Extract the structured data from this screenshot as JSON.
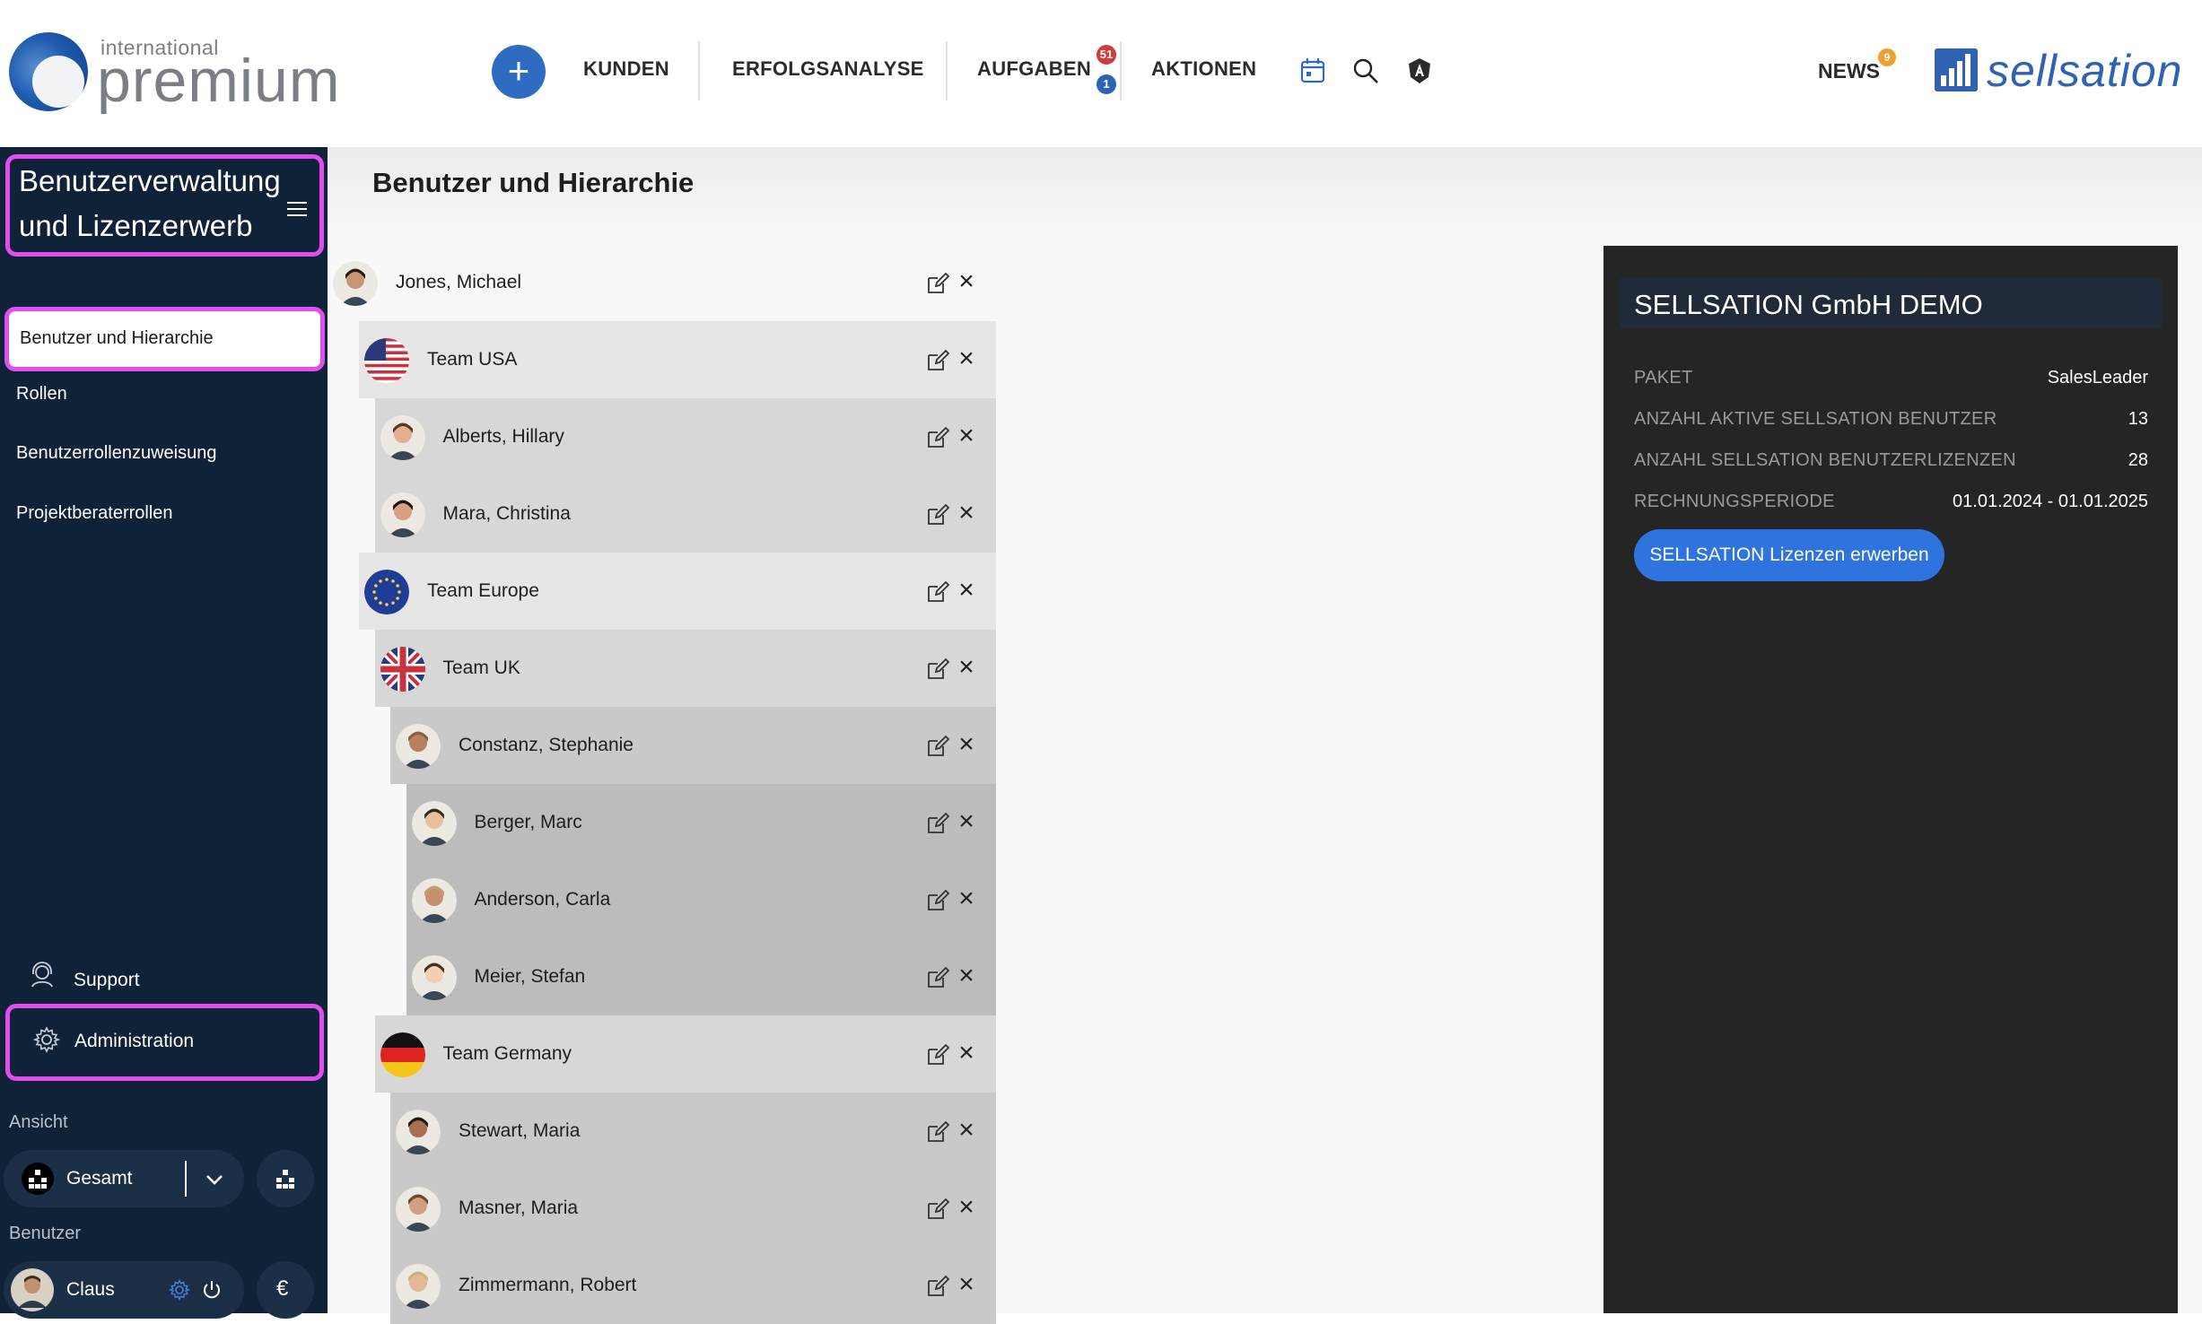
{
  "header": {
    "logo_small": "international",
    "logo_big": "premium",
    "nav": [
      "KUNDEN",
      "ERFOLGSANALYSE",
      "AUFGABEN",
      "AKTIONEN"
    ],
    "aufgaben_badge_red": "51",
    "aufgaben_badge_blue": "1",
    "news_label": "NEWS",
    "news_badge": "9",
    "brand": "sellsation",
    "accent_color": "#2e6cc2",
    "icons": [
      "plus-icon",
      "calendar-icon",
      "search-icon",
      "shield-icon"
    ]
  },
  "sidebar": {
    "title": "Benutzerverwaltung und Lizenzerwerb",
    "items": [
      "Benutzer und Hierarchie",
      "Rollen",
      "Benutzerrollenzuweisung",
      "Projektberaterrollen"
    ],
    "active_item": "Benutzer und Hierarchie",
    "support_label": "Support",
    "admin_label": "Administration",
    "view_caption": "Ansicht",
    "view_value": "Gesamt",
    "user_caption": "Benutzer",
    "user_name": "Claus",
    "currency_symbol": "€",
    "highlight_color": "#e14ef0"
  },
  "page": {
    "title": "Benutzer und Hierarchie"
  },
  "hierarchy": [
    {
      "name": "Jones, Michael",
      "level": 0,
      "type": "user"
    },
    {
      "name": "Team USA",
      "level": 1,
      "type": "team",
      "flag": "us"
    },
    {
      "name": "Alberts, Hillary",
      "level": 2,
      "type": "user"
    },
    {
      "name": "Mara, Christina",
      "level": 2,
      "type": "user"
    },
    {
      "name": "Team Europe",
      "level": 1,
      "type": "team",
      "flag": "eu"
    },
    {
      "name": "Team UK",
      "level": 2,
      "type": "team",
      "flag": "uk"
    },
    {
      "name": "Constanz, Stephanie",
      "level": 3,
      "type": "user"
    },
    {
      "name": "Berger, Marc",
      "level": 4,
      "type": "user"
    },
    {
      "name": "Anderson, Carla",
      "level": 4,
      "type": "user"
    },
    {
      "name": "Meier, Stefan",
      "level": 4,
      "type": "user"
    },
    {
      "name": "Team Germany",
      "level": 2,
      "type": "team",
      "flag": "de"
    },
    {
      "name": "Stewart, Maria",
      "level": 3,
      "type": "user"
    },
    {
      "name": "Masner, Maria",
      "level": 3,
      "type": "user"
    },
    {
      "name": "Zimmermann, Robert",
      "level": 3,
      "type": "user"
    }
  ],
  "license_panel": {
    "title": "SELLSATION GmbH DEMO",
    "rows": [
      {
        "label": "PAKET",
        "value": "SalesLeader"
      },
      {
        "label": "ANZAHL AKTIVE SELLSATION BENUTZER",
        "value": "13"
      },
      {
        "label": "ANZAHL SELLSATION BENUTZERLIZENZEN",
        "value": "28"
      },
      {
        "label": "RECHNUNGSPERIODE",
        "value": "01.01.2024 - 01.01.2025"
      }
    ],
    "button_label": "SELLSATION Lizenzen erwerben"
  }
}
